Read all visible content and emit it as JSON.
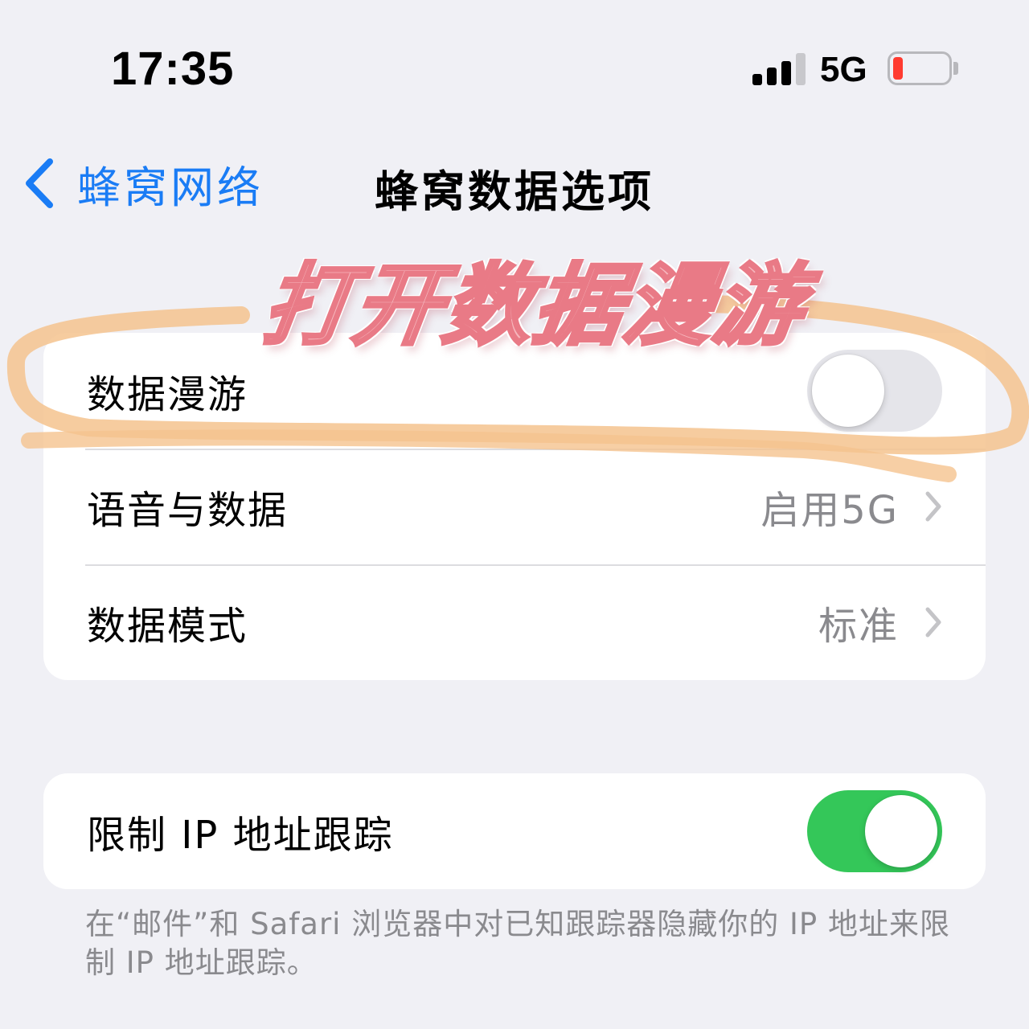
{
  "status_bar": {
    "time": "17:35",
    "network": "5G",
    "signal_bars_active": 3,
    "signal_bars_total": 4,
    "battery_level": 0.1,
    "battery_color": "#ff3b30"
  },
  "nav": {
    "back_icon": "chevron-left-icon",
    "back_label": "蜂窝网络",
    "title": "蜂窝数据选项"
  },
  "overlay": {
    "text": "打开数据漫游",
    "color": "#f6b7bd",
    "highlight_color": "#f5c38e"
  },
  "group1": {
    "rows": [
      {
        "label": "数据漫游",
        "toggle_on": false
      },
      {
        "label": "语音与数据",
        "value": "启用5G",
        "icon": "chevron-right-icon"
      },
      {
        "label": "数据模式",
        "value": "标准",
        "icon": "chevron-right-icon"
      }
    ]
  },
  "group2": {
    "rows": [
      {
        "label": "限制 IP 地址跟踪",
        "toggle_on": true
      }
    ],
    "footer": "在“邮件”和 Safari 浏览器中对已知跟踪器隐藏你的 IP 地址来限制 IP 地址跟踪。"
  },
  "colors": {
    "accent": "#1a7cf5",
    "toggle_on": "#34c759",
    "toggle_off": "#e5e5ea",
    "background": "#f0f0f5"
  }
}
